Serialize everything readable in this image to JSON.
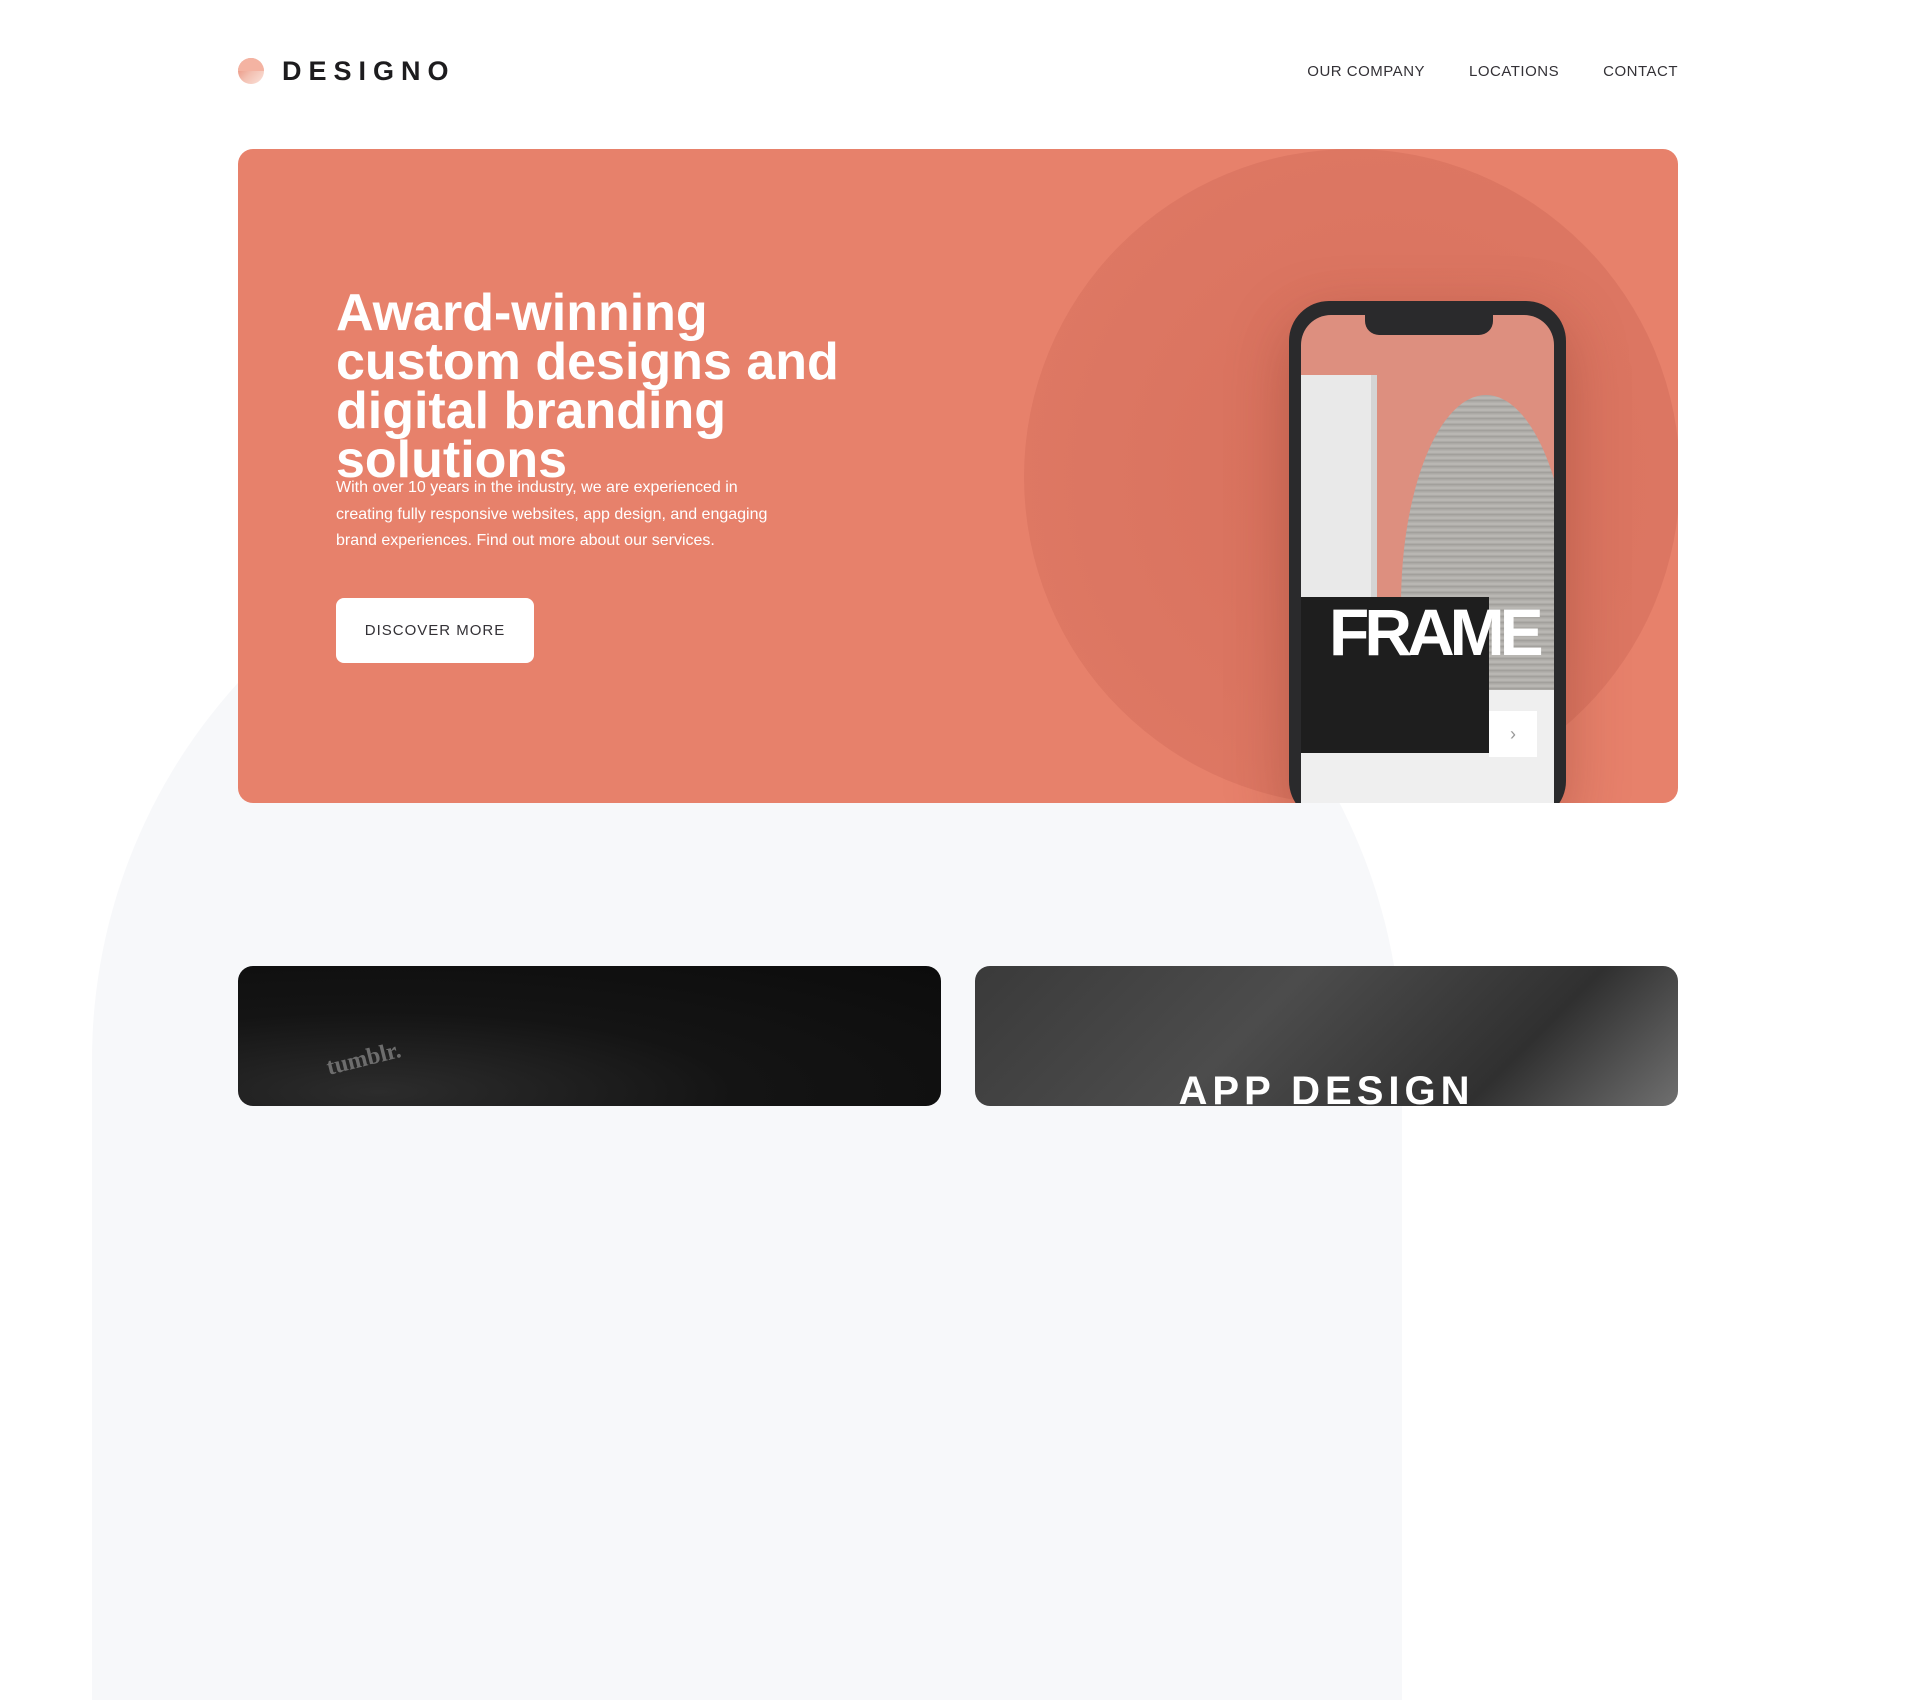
{
  "brand": {
    "name": "DESIGNO",
    "accent": "#e7816b"
  },
  "nav": [
    {
      "label": "OUR COMPANY"
    },
    {
      "label": "LOCATIONS"
    },
    {
      "label": "CONTACT"
    }
  ],
  "hero": {
    "title": "Award-winning custom designs and digital branding solutions",
    "text": "With over 10 years in the industry, we are experienced in creating fully responsive websites, app design, and engaging brand experiences. Find out more about our services.",
    "button_label": "DISCOVER MORE",
    "phone_image_text": "FRAME"
  },
  "projects": [
    {
      "label": "",
      "image_text": "tumblr."
    },
    {
      "label": "APP DESIGN"
    }
  ]
}
